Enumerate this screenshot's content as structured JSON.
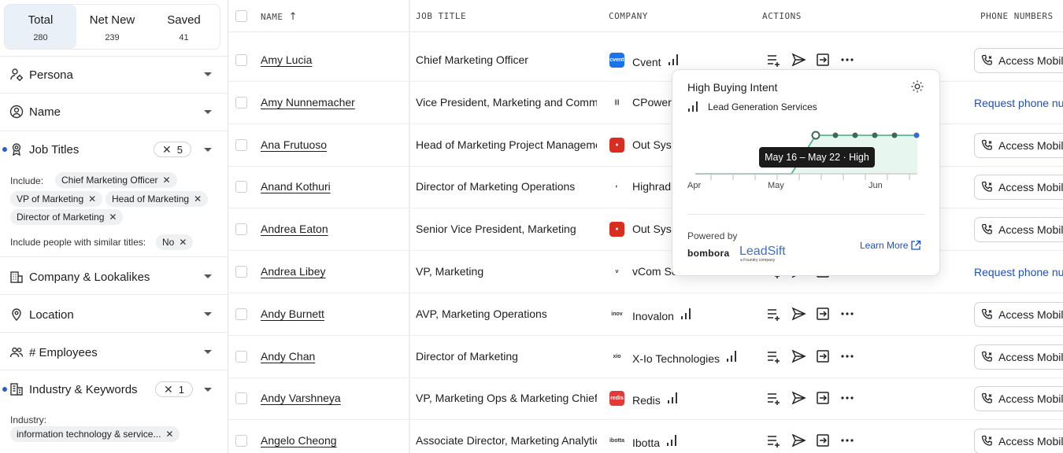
{
  "tabs": [
    {
      "label": "Total",
      "count": "280"
    },
    {
      "label": "Net New",
      "count": "239"
    },
    {
      "label": "Saved",
      "count": "41"
    }
  ],
  "filters": {
    "persona": "Persona",
    "name": "Name",
    "job_titles": {
      "label": "Job Titles",
      "count": "5",
      "include_label": "Include:",
      "chips": [
        "Chief Marketing Officer",
        "VP of Marketing",
        "Head of Marketing",
        "Director of Marketing"
      ],
      "similar_label": "Include people with similar titles:",
      "similar_value": "No"
    },
    "company": "Company & Lookalikes",
    "location": "Location",
    "employees": "# Employees",
    "industry": {
      "label": "Industry & Keywords",
      "count": "1",
      "industry_label": "Industry:",
      "chip": "information technology & service..."
    }
  },
  "headers": {
    "name": "NAME",
    "job_title": "JOB TITLE",
    "company": "COMPANY",
    "actions": "ACTIONS",
    "phone": "PHONE NUMBERS"
  },
  "rows": [
    {
      "name": "Amy Lucia",
      "job": "Chief Marketing Officer",
      "company": "Cvent",
      "logo_color": "#1a73e8",
      "logo_text": "cvent",
      "intent": true,
      "phone": "Access Mobile",
      "phone_type": "access"
    },
    {
      "name": "Amy Nunnemacher",
      "job": "Vice President, Marketing and Communications",
      "company": "CPower",
      "logo_color": "#ffffff",
      "logo_text": "|||",
      "intent": false,
      "phone": "Request phone number",
      "phone_type": "request"
    },
    {
      "name": "Ana Frutuoso",
      "job": "Head of Marketing Project Management",
      "company": "Out Systems",
      "logo_color": "#d92d20",
      "logo_text": "●",
      "intent": false,
      "phone": "Access Mobile",
      "phone_type": "access"
    },
    {
      "name": "Anand Kothuri",
      "job": "Director of Marketing Operations",
      "company": "Highradius",
      "logo_color": "#ffffff",
      "logo_text": "◐",
      "intent": false,
      "phone": "Access Mobile",
      "phone_type": "access"
    },
    {
      "name": "Andrea Eaton",
      "job": "Senior Vice President, Marketing",
      "company": "Out Systems",
      "logo_color": "#d92d20",
      "logo_text": "●",
      "intent": false,
      "phone": "Access Mobile",
      "phone_type": "access"
    },
    {
      "name": "Andrea Libey",
      "job": "VP, Marketing",
      "company": "vCom Solutions",
      "logo_color": "#ffffff",
      "logo_text": "v",
      "intent": false,
      "phone": "Request phone number",
      "phone_type": "request"
    },
    {
      "name": "Andy Burnett",
      "job": "AVP, Marketing Operations",
      "company": "Inovalon",
      "logo_color": "#ffffff",
      "logo_text": "inov",
      "intent": true,
      "phone": "Access Mobile",
      "phone_type": "access"
    },
    {
      "name": "Andy Chan",
      "job": "Director of Marketing",
      "company": "X-Io Technologies",
      "logo_color": "#ffffff",
      "logo_text": "xio",
      "intent": true,
      "phone": "Access Mobile",
      "phone_type": "access"
    },
    {
      "name": "Andy Varshneya",
      "job": "VP, Marketing Ops & Marketing Chief of Staff",
      "company": "Redis",
      "logo_color": "#e53935",
      "logo_text": "redis",
      "intent": true,
      "phone": "Access Mobile",
      "phone_type": "access"
    },
    {
      "name": "Angelo Cheong",
      "job": "Associate Director, Marketing Analytics",
      "company": "Ibotta",
      "logo_color": "#ffffff",
      "logo_text": "ibotta",
      "intent": true,
      "phone": "Access Mobile",
      "phone_type": "access"
    }
  ],
  "popover": {
    "title": "High Buying Intent",
    "topic": "Lead Generation Services",
    "tooltip": "May 16 – May 22 · High",
    "x_ticks": [
      "Apr",
      "May",
      "Jun"
    ],
    "powered_by": "Powered by",
    "brand1": "bombora",
    "brand2": "LeadSift",
    "brand2_sub": "a Foundry company",
    "learn_more": "Learn More"
  }
}
